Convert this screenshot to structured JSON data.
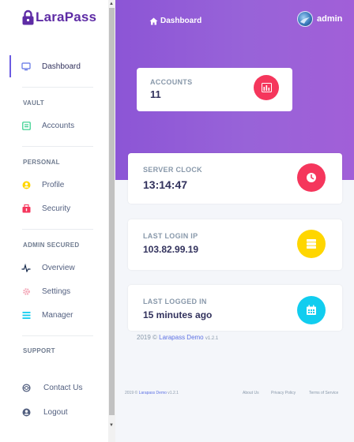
{
  "brand": {
    "name": "LaraPass"
  },
  "nav": {
    "dashboard": "Dashboard",
    "vault_section": "VAULT",
    "accounts": "Accounts",
    "personal_section": "PERSONAL",
    "profile": "Profile",
    "security": "Security",
    "admin_section": "ADMIN SECURED",
    "overview": "Overview",
    "settings": "Settings",
    "manager": "Manager",
    "support_section": "SUPPORT",
    "contact": "Contact Us",
    "logout": "Logout"
  },
  "topbar": {
    "title": "Dashboard",
    "username": "admin"
  },
  "cards": {
    "accounts": {
      "title": "ACCOUNTS",
      "value": "11",
      "color": "#f5365c"
    },
    "clock": {
      "title": "SERVER CLOCK",
      "value": "13:14:47",
      "color": "#f5365c"
    },
    "ip": {
      "title": "LAST LOGIN IP",
      "value": "103.82.99.19",
      "color": "#ffd600"
    },
    "logged": {
      "title": "LAST LOGGED IN",
      "value": "15 minutes ago",
      "color": "#11cdef"
    }
  },
  "footer": {
    "year": "2019 ©",
    "link": "Larapass Demo",
    "version": "v1.2.1",
    "small_year": "2019 ©",
    "small_link": "Larapass Demo",
    "small_version": "v1.2.1",
    "about": "About Us",
    "privacy": "Privacy Policy",
    "terms": "Terms of Service"
  },
  "colors": {
    "accent": "#8c55d6",
    "brand": "#5e2ca5"
  }
}
